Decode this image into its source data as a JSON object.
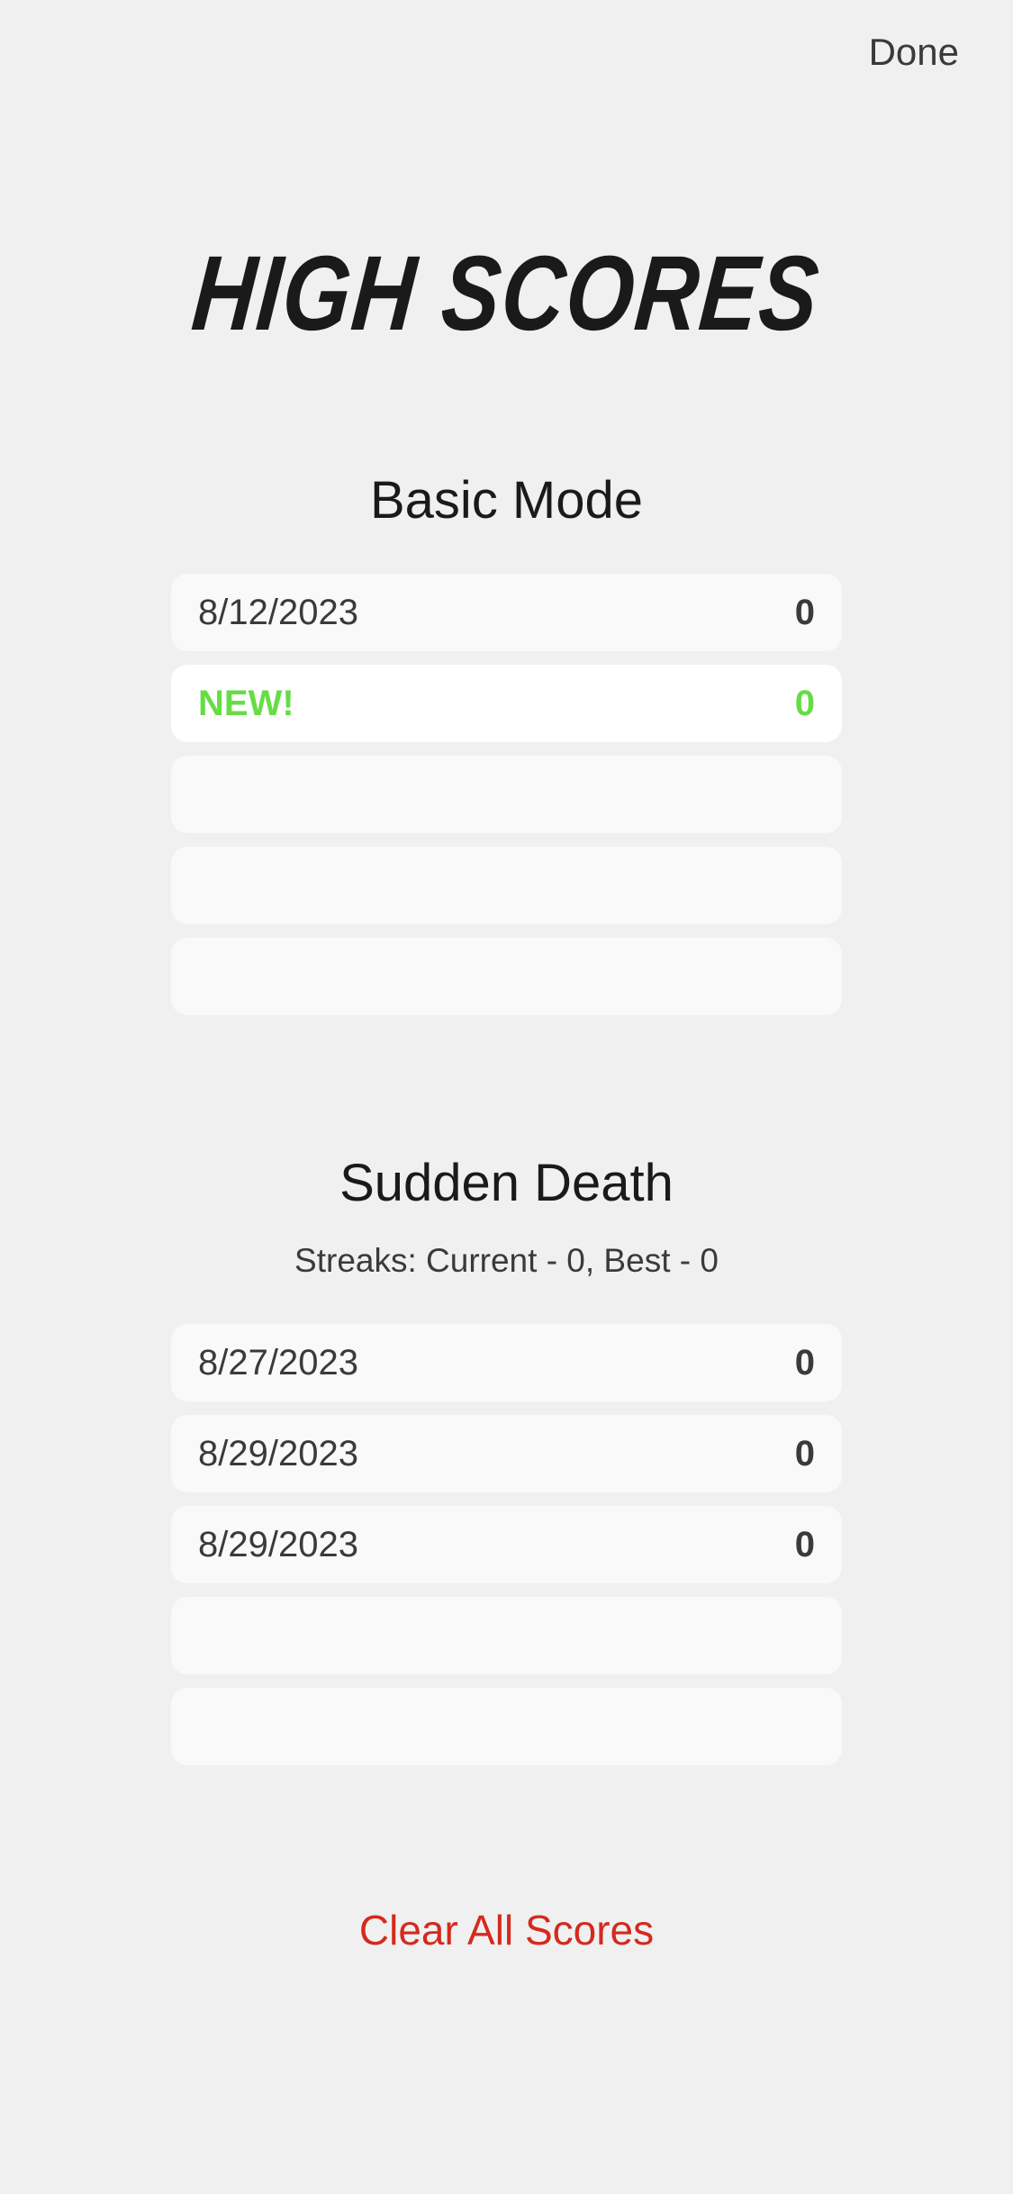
{
  "header": {
    "done_label": "Done"
  },
  "title": "HIGH SCORES",
  "basic_mode": {
    "title": "Basic Mode",
    "rows": [
      {
        "date": "8/12/2023",
        "score": "0"
      },
      {
        "date": "NEW!",
        "score": "0"
      },
      {
        "date": "",
        "score": ""
      },
      {
        "date": "",
        "score": ""
      },
      {
        "date": "",
        "score": ""
      }
    ]
  },
  "sudden_death": {
    "title": "Sudden Death",
    "streaks": "Streaks: Current - 0, Best - 0",
    "rows": [
      {
        "date": "8/27/2023",
        "score": "0"
      },
      {
        "date": "8/29/2023",
        "score": "0"
      },
      {
        "date": "8/29/2023",
        "score": "0"
      },
      {
        "date": "",
        "score": ""
      },
      {
        "date": "",
        "score": ""
      }
    ]
  },
  "clear_label": "Clear All Scores",
  "colors": {
    "background": "#f0f0f0",
    "new_highlight": "#66dd44",
    "destructive": "#d42a1e"
  }
}
